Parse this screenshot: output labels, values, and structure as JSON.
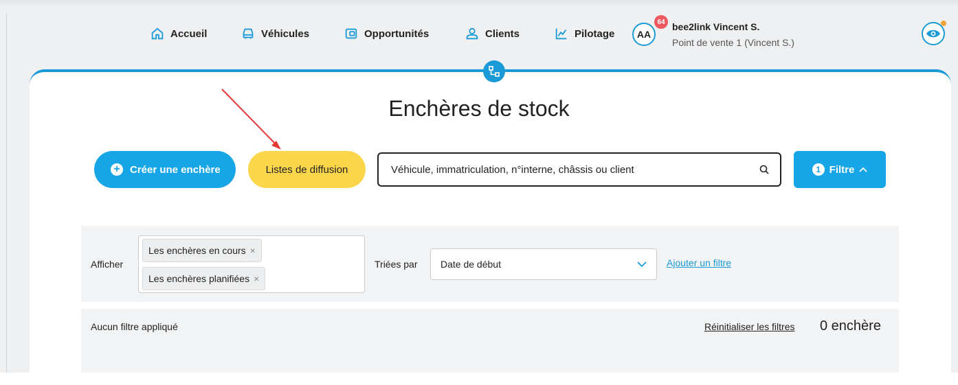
{
  "nav": {
    "items": [
      {
        "label": "Accueil",
        "icon": "home-icon"
      },
      {
        "label": "Véhicules",
        "icon": "car-icon"
      },
      {
        "label": "Opportunités",
        "icon": "wallet-icon"
      },
      {
        "label": "Clients",
        "icon": "user-icon"
      },
      {
        "label": "Pilotage",
        "icon": "chart-icon"
      }
    ],
    "avatar_initials": "AA",
    "notifications_count": "64",
    "user_name": "bee2link Vincent S.",
    "store_name": "Point de vente 1 (Vincent S.)"
  },
  "main": {
    "title": "Enchères de stock",
    "create_button": "Créer une enchère",
    "lists_button": "Listes de diffusion",
    "search_placeholder": "Véhicule, immatriculation, n°interne, châssis ou client",
    "filter_count": "1",
    "filter_button": "Filtre"
  },
  "filters": {
    "show_label": "Afficher",
    "tags": [
      "Les enchères en cours",
      "Les enchères planifiées"
    ],
    "sort_label": "Triées par",
    "sort_value": "Date de début",
    "add_filter": "Ajouter un filtre"
  },
  "results": {
    "no_filter": "Aucun filtre appliqué",
    "reset": "Réinitialiser les filtres",
    "count": "0 enchère"
  },
  "colors": {
    "accent": "#16a6e8",
    "secondary": "#fbd64a",
    "badge": "#ec5a5f"
  }
}
